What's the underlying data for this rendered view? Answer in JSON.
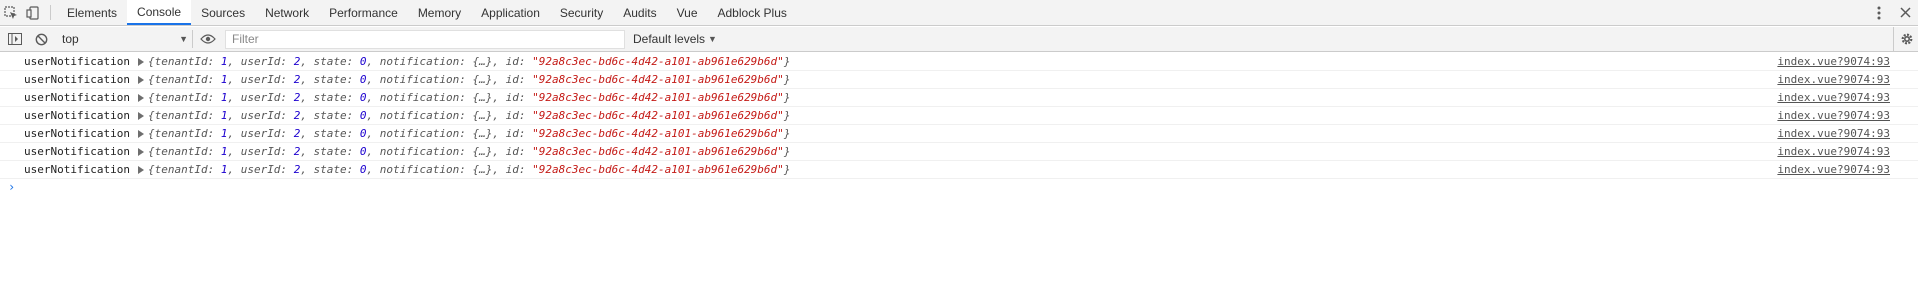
{
  "tabbar": {
    "tabs": [
      {
        "label": "Elements"
      },
      {
        "label": "Console"
      },
      {
        "label": "Sources"
      },
      {
        "label": "Network"
      },
      {
        "label": "Performance"
      },
      {
        "label": "Memory"
      },
      {
        "label": "Application"
      },
      {
        "label": "Security"
      },
      {
        "label": "Audits"
      },
      {
        "label": "Vue"
      },
      {
        "label": "Adblock Plus"
      }
    ],
    "active_tab": "Console"
  },
  "console_toolbar": {
    "context_label": "top",
    "filter_placeholder": "Filter",
    "levels_label": "Default levels"
  },
  "messages": [
    {
      "label": "userNotification",
      "tenantId": "1",
      "userId": "2",
      "state": "0",
      "notification": "{…}",
      "id": "\"92a8c3ec-bd6c-4d42-a101-ab961e629b6d\"",
      "source": "index.vue?9074:93"
    },
    {
      "label": "userNotification",
      "tenantId": "1",
      "userId": "2",
      "state": "0",
      "notification": "{…}",
      "id": "\"92a8c3ec-bd6c-4d42-a101-ab961e629b6d\"",
      "source": "index.vue?9074:93"
    },
    {
      "label": "userNotification",
      "tenantId": "1",
      "userId": "2",
      "state": "0",
      "notification": "{…}",
      "id": "\"92a8c3ec-bd6c-4d42-a101-ab961e629b6d\"",
      "source": "index.vue?9074:93"
    },
    {
      "label": "userNotification",
      "tenantId": "1",
      "userId": "2",
      "state": "0",
      "notification": "{…}",
      "id": "\"92a8c3ec-bd6c-4d42-a101-ab961e629b6d\"",
      "source": "index.vue?9074:93"
    },
    {
      "label": "userNotification",
      "tenantId": "1",
      "userId": "2",
      "state": "0",
      "notification": "{…}",
      "id": "\"92a8c3ec-bd6c-4d42-a101-ab961e629b6d\"",
      "source": "index.vue?9074:93"
    },
    {
      "label": "userNotification",
      "tenantId": "1",
      "userId": "2",
      "state": "0",
      "notification": "{…}",
      "id": "\"92a8c3ec-bd6c-4d42-a101-ab961e629b6d\"",
      "source": "index.vue?9074:93"
    },
    {
      "label": "userNotification",
      "tenantId": "1",
      "userId": "2",
      "state": "0",
      "notification": "{…}",
      "id": "\"92a8c3ec-bd6c-4d42-a101-ab961e629b6d\"",
      "source": "index.vue?9074:93"
    }
  ],
  "prompt_symbol": "›",
  "icons": {
    "inspect": "inspect-element-icon",
    "device": "device-toolbar-icon",
    "menu": "kebab-menu-icon",
    "close": "close-icon",
    "sidebar": "console-sidebar-icon",
    "clear": "clear-console-icon",
    "eye": "live-expression-eye-icon",
    "settings": "gear-icon"
  },
  "colors": {
    "active_tab_underline": "#1a73e8",
    "number": "#1c00cf",
    "string": "#c41a16",
    "prompt": "#1a73e8"
  }
}
